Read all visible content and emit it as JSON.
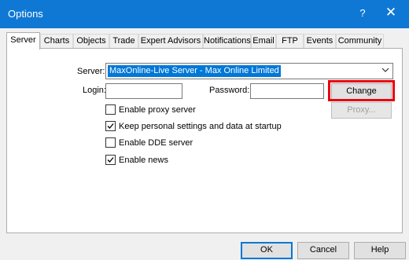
{
  "window": {
    "title": "Options",
    "help_glyph": "?",
    "close_glyph": "✕"
  },
  "tabs": [
    {
      "label": "Server",
      "active": true
    },
    {
      "label": "Charts"
    },
    {
      "label": "Objects"
    },
    {
      "label": "Trade"
    },
    {
      "label": "Expert Advisors"
    },
    {
      "label": "Notifications"
    },
    {
      "label": "Email"
    },
    {
      "label": "FTP"
    },
    {
      "label": "Events"
    },
    {
      "label": "Community"
    }
  ],
  "server": {
    "server_label": "Server:",
    "server_value": "MaxOnline-Live Server - Max Online Limited",
    "login_label": "Login:",
    "login_value": "",
    "password_label": "Password:",
    "password_value": "",
    "change_label": "Change",
    "proxy_label": "Proxy...",
    "checkboxes": [
      {
        "label": "Enable proxy server",
        "checked": false
      },
      {
        "label": "Keep personal settings and data at startup",
        "checked": true
      },
      {
        "label": "Enable DDE server",
        "checked": false
      },
      {
        "label": "Enable news",
        "checked": true
      }
    ]
  },
  "footer": {
    "ok_label": "OK",
    "cancel_label": "Cancel",
    "help_label": "Help"
  },
  "colors": {
    "titlebar": "#0f78d4",
    "highlight_border": "#e8000d",
    "selection": "#0078d7"
  }
}
